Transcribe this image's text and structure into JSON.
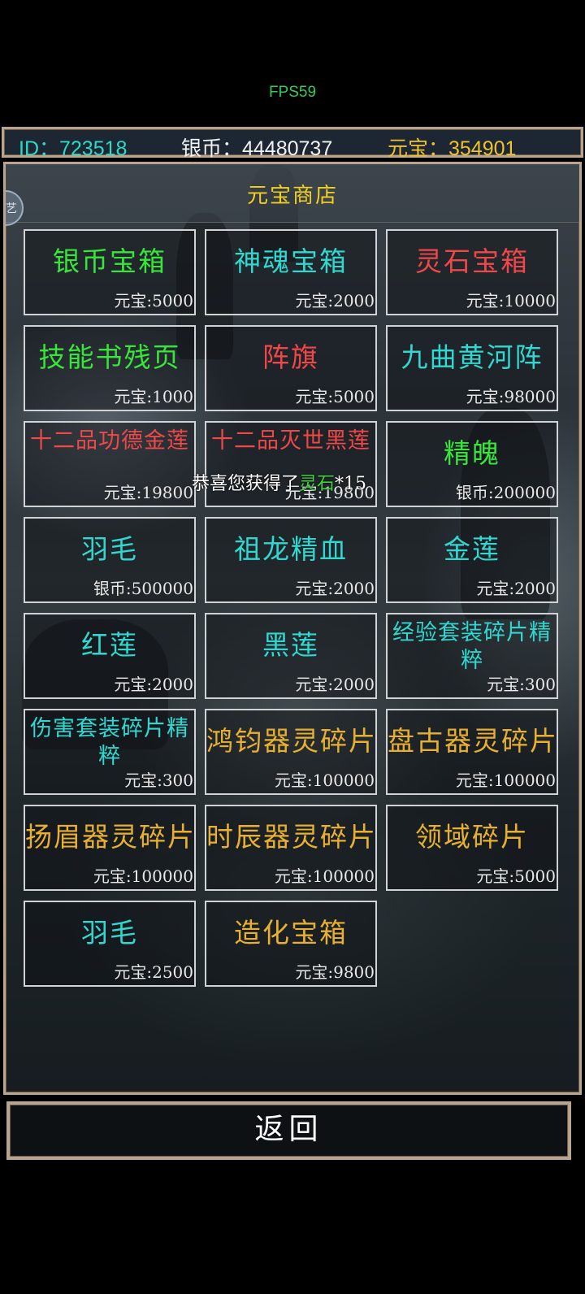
{
  "fps": "FPS59",
  "topbar": {
    "id_text": "ID：723518",
    "silver_text": "银币：44480737",
    "gold_text": "元宝：354901"
  },
  "side_button_glyph": "艺",
  "shop": {
    "title": "元宝商店",
    "items": [
      {
        "name": "银币宝箱",
        "price": "元宝:5000",
        "color": "#38e53a"
      },
      {
        "name": "神魂宝箱",
        "price": "元宝:2000",
        "color": "#30d8d0"
      },
      {
        "name": "灵石宝箱",
        "price": "元宝:10000",
        "color": "#f04848"
      },
      {
        "name": "技能书残页",
        "price": "元宝:1000",
        "color": "#38e53a"
      },
      {
        "name": "阵旗",
        "price": "元宝:5000",
        "color": "#f04848"
      },
      {
        "name": "九曲黄河阵",
        "price": "元宝:98000",
        "color": "#30d8d0"
      },
      {
        "name": "十二品功德金莲",
        "price": "元宝:19800",
        "color": "#f04848"
      },
      {
        "name": "十二品灭世黑莲",
        "price": "元宝:19800",
        "color": "#f04848"
      },
      {
        "name": "精魄",
        "price": "银币:200000",
        "color": "#38e53a"
      },
      {
        "name": "羽毛",
        "price": "银币:500000",
        "color": "#30d8d0"
      },
      {
        "name": "祖龙精血",
        "price": "元宝:2000",
        "color": "#30d8d0"
      },
      {
        "name": "金莲",
        "price": "元宝:2000",
        "color": "#30d8d0"
      },
      {
        "name": "红莲",
        "price": "元宝:2000",
        "color": "#30d8d0"
      },
      {
        "name": "黑莲",
        "price": "元宝:2000",
        "color": "#30d8d0"
      },
      {
        "name": "经验套装碎片精粹",
        "price": "元宝:300",
        "color": "#30d8d0"
      },
      {
        "name": "伤害套装碎片精粹",
        "price": "元宝:300",
        "color": "#30d8d0"
      },
      {
        "name": "鸿钧器灵碎片",
        "price": "元宝:100000",
        "color": "#e8b030"
      },
      {
        "name": "盘古器灵碎片",
        "price": "元宝:100000",
        "color": "#e8b030"
      },
      {
        "name": "扬眉器灵碎片",
        "price": "元宝:100000",
        "color": "#e8b030"
      },
      {
        "name": "时辰器灵碎片",
        "price": "元宝:100000",
        "color": "#e8b030"
      },
      {
        "name": "领域碎片",
        "price": "元宝:5000",
        "color": "#e8b030"
      },
      {
        "name": "羽毛",
        "price": "元宝:2500",
        "color": "#30d8d0"
      },
      {
        "name": "造化宝箱",
        "price": "元宝:9800",
        "color": "#e8b030"
      }
    ]
  },
  "toast": {
    "prefix": "恭喜您获得了",
    "item": "灵石",
    "suffix": "*15"
  },
  "back_label": "返回"
}
